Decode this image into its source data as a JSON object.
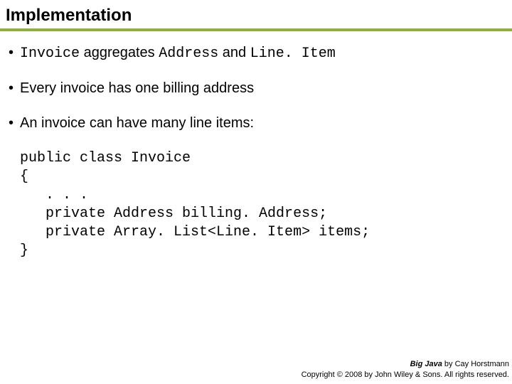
{
  "heading": "Implementation",
  "bullets": {
    "b1": {
      "seg1": "Invoice",
      "seg2": " aggregates ",
      "seg3": "Address",
      "seg4": " and ",
      "seg5": "Line. Item"
    },
    "b2": "Every invoice has one billing address",
    "b3": "An invoice can have many line items:"
  },
  "code": "public class Invoice\n{\n   . . .\n   private Address billing. Address;\n   private Array. List<Line. Item> items;\n}",
  "footer": {
    "line1_book": "Big Java",
    "line1_rest": " by Cay Horstmann",
    "line2": "Copyright © 2008 by John Wiley & Sons.  All rights reserved."
  }
}
